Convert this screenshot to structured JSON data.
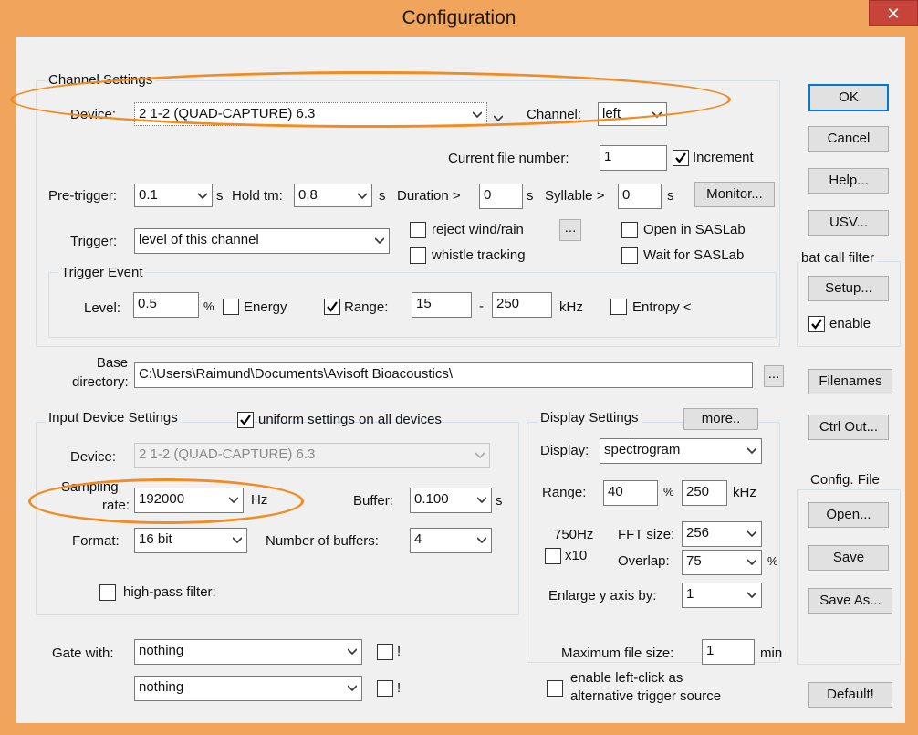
{
  "dialog": {
    "title": "Configuration",
    "close_label": "✕",
    "accent_color": "#f28b21",
    "frame_color": "#f0a45c"
  },
  "channel": {
    "group_title": "Channel Settings",
    "device_label": "Device:",
    "device_value": "2 1-2 (QUAD-CAPTURE) 6.3",
    "channel_label": "Channel:",
    "channel_value": "left",
    "current_file_label": "Current file number:",
    "current_file_value": "1",
    "increment_label": "Increment",
    "increment_checked": true,
    "pretrigger_label": "Pre-trigger:",
    "pretrigger_value": "0.1",
    "pretrigger_unit": "s",
    "holdtm_label": "Hold tm:",
    "holdtm_value": "0.8",
    "holdtm_unit": "s",
    "duration_label": "Duration >",
    "duration_value": "0",
    "duration_unit": "s",
    "syllable_label": "Syllable >",
    "syllable_value": "0",
    "syllable_unit": "s",
    "monitor_label": "Monitor...",
    "trigger_label": "Trigger:",
    "trigger_value": "level of this channel",
    "reject_label": "reject wind/rain",
    "reject_more": "...",
    "whistle_label": "whistle tracking",
    "open_saslab_label": "Open in SASLab",
    "wait_saslab_label": "Wait for SASLab"
  },
  "trigger_event": {
    "group_title": "Trigger Event",
    "level_label": "Level:",
    "level_value": "0.5",
    "level_unit": "%",
    "energy_label": "Energy",
    "range_label": "Range:",
    "range_checked": true,
    "range_from": "15",
    "range_sep": "-",
    "range_to": "250",
    "range_unit": "kHz",
    "entropy_label": "Entropy <"
  },
  "base": {
    "label_line1": "Base",
    "label_line2": "directory:",
    "value": "C:\\Users\\Raimund\\Documents\\Avisoft Bioacoustics\\",
    "browse": "..."
  },
  "input": {
    "group_title": "Input Device Settings",
    "uniform_label": "uniform settings on all devices",
    "uniform_checked": true,
    "device_label": "Device:",
    "device_value": "2 1-2 (QUAD-CAPTURE) 6.3",
    "sampling_label_line1": "Sampling",
    "sampling_label_line2": "rate:",
    "sampling_value": "192000",
    "sampling_unit": "Hz",
    "buffer_label": "Buffer:",
    "buffer_value": "0.100",
    "buffer_unit": "s",
    "format_label": "Format:",
    "format_value": "16 bit",
    "numbuf_label": "Number of buffers:",
    "numbuf_value": "4",
    "highpass_label": "high-pass filter:"
  },
  "display": {
    "group_title": "Display Settings",
    "more_label": "more..",
    "display_label": "Display:",
    "display_value": "spectrogram",
    "range_label": "Range:",
    "range_value": "40",
    "range_unit": "%",
    "range_khz_value": "250",
    "range_khz_unit": "kHz",
    "resolution": "750Hz",
    "fft_label": "FFT size:",
    "fft_value": "256",
    "x10_label": "x10",
    "overlap_label": "Overlap:",
    "overlap_value": "75",
    "overlap_unit": "%",
    "enlarge_label": "Enlarge y axis by:",
    "enlarge_value": "1"
  },
  "gate": {
    "label": "Gate with:",
    "first_value": "nothing",
    "second_value": "nothing",
    "bang": "!"
  },
  "maxfile": {
    "label": "Maximum file size:",
    "value": "1",
    "unit": "min"
  },
  "leftclick": {
    "line1": "enable left-click as",
    "line2": "alternative trigger source"
  },
  "side": {
    "ok": "OK",
    "cancel": "Cancel",
    "help": "Help...",
    "usv": "USV...",
    "bat_title": "bat call filter",
    "setup": "Setup...",
    "enable_label": "enable",
    "enable_checked": true,
    "filenames": "Filenames",
    "ctrl_out": "Ctrl Out...",
    "config_title": "Config. File",
    "open": "Open...",
    "save": "Save",
    "save_as": "Save As...",
    "default": "Default!"
  }
}
